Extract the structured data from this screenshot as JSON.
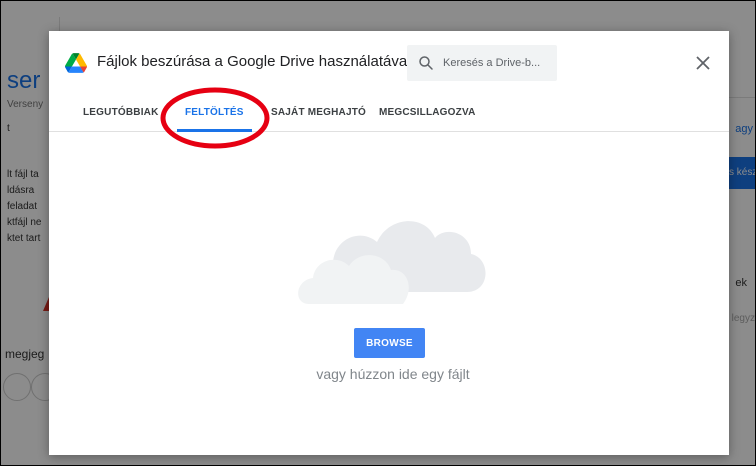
{
  "background": {
    "big_fragment": "ser",
    "fragments_top": [
      "Verseny",
      "t"
    ],
    "fragments_left": [
      "lt fájl ta",
      "ldásra",
      "feladat",
      "ktfájl ne",
      "ktet tart"
    ],
    "fragment_bottom": "megjeg",
    "right_fragments": [
      "agy",
      "s kész",
      "ek",
      "legyz"
    ]
  },
  "dialog": {
    "title": "Fájlok beszúrása a Google Drive használatával",
    "search": {
      "placeholder": "Keresés a Drive-b..."
    },
    "close_label": "×",
    "tabs": [
      {
        "label": "LEGUTÓBBIAK",
        "active": false
      },
      {
        "label": "FELTÖLTÉS",
        "active": true
      },
      {
        "label": "SAJÁT MEGHAJTÓ",
        "active": false
      },
      {
        "label": "MEGCSILLAGOZVA",
        "active": false
      }
    ],
    "browse_label": "BROWSE",
    "drop_text": "vagy húzzon ide egy fájlt"
  },
  "colors": {
    "accent": "#1a73e8",
    "browse_button": "#4285f4",
    "annotation": "#e60012",
    "overlay": "#00000073"
  },
  "icons": {
    "logo": "google-drive-icon",
    "search": "search-icon",
    "close": "close-icon",
    "illustration": "cloud-illustration"
  }
}
